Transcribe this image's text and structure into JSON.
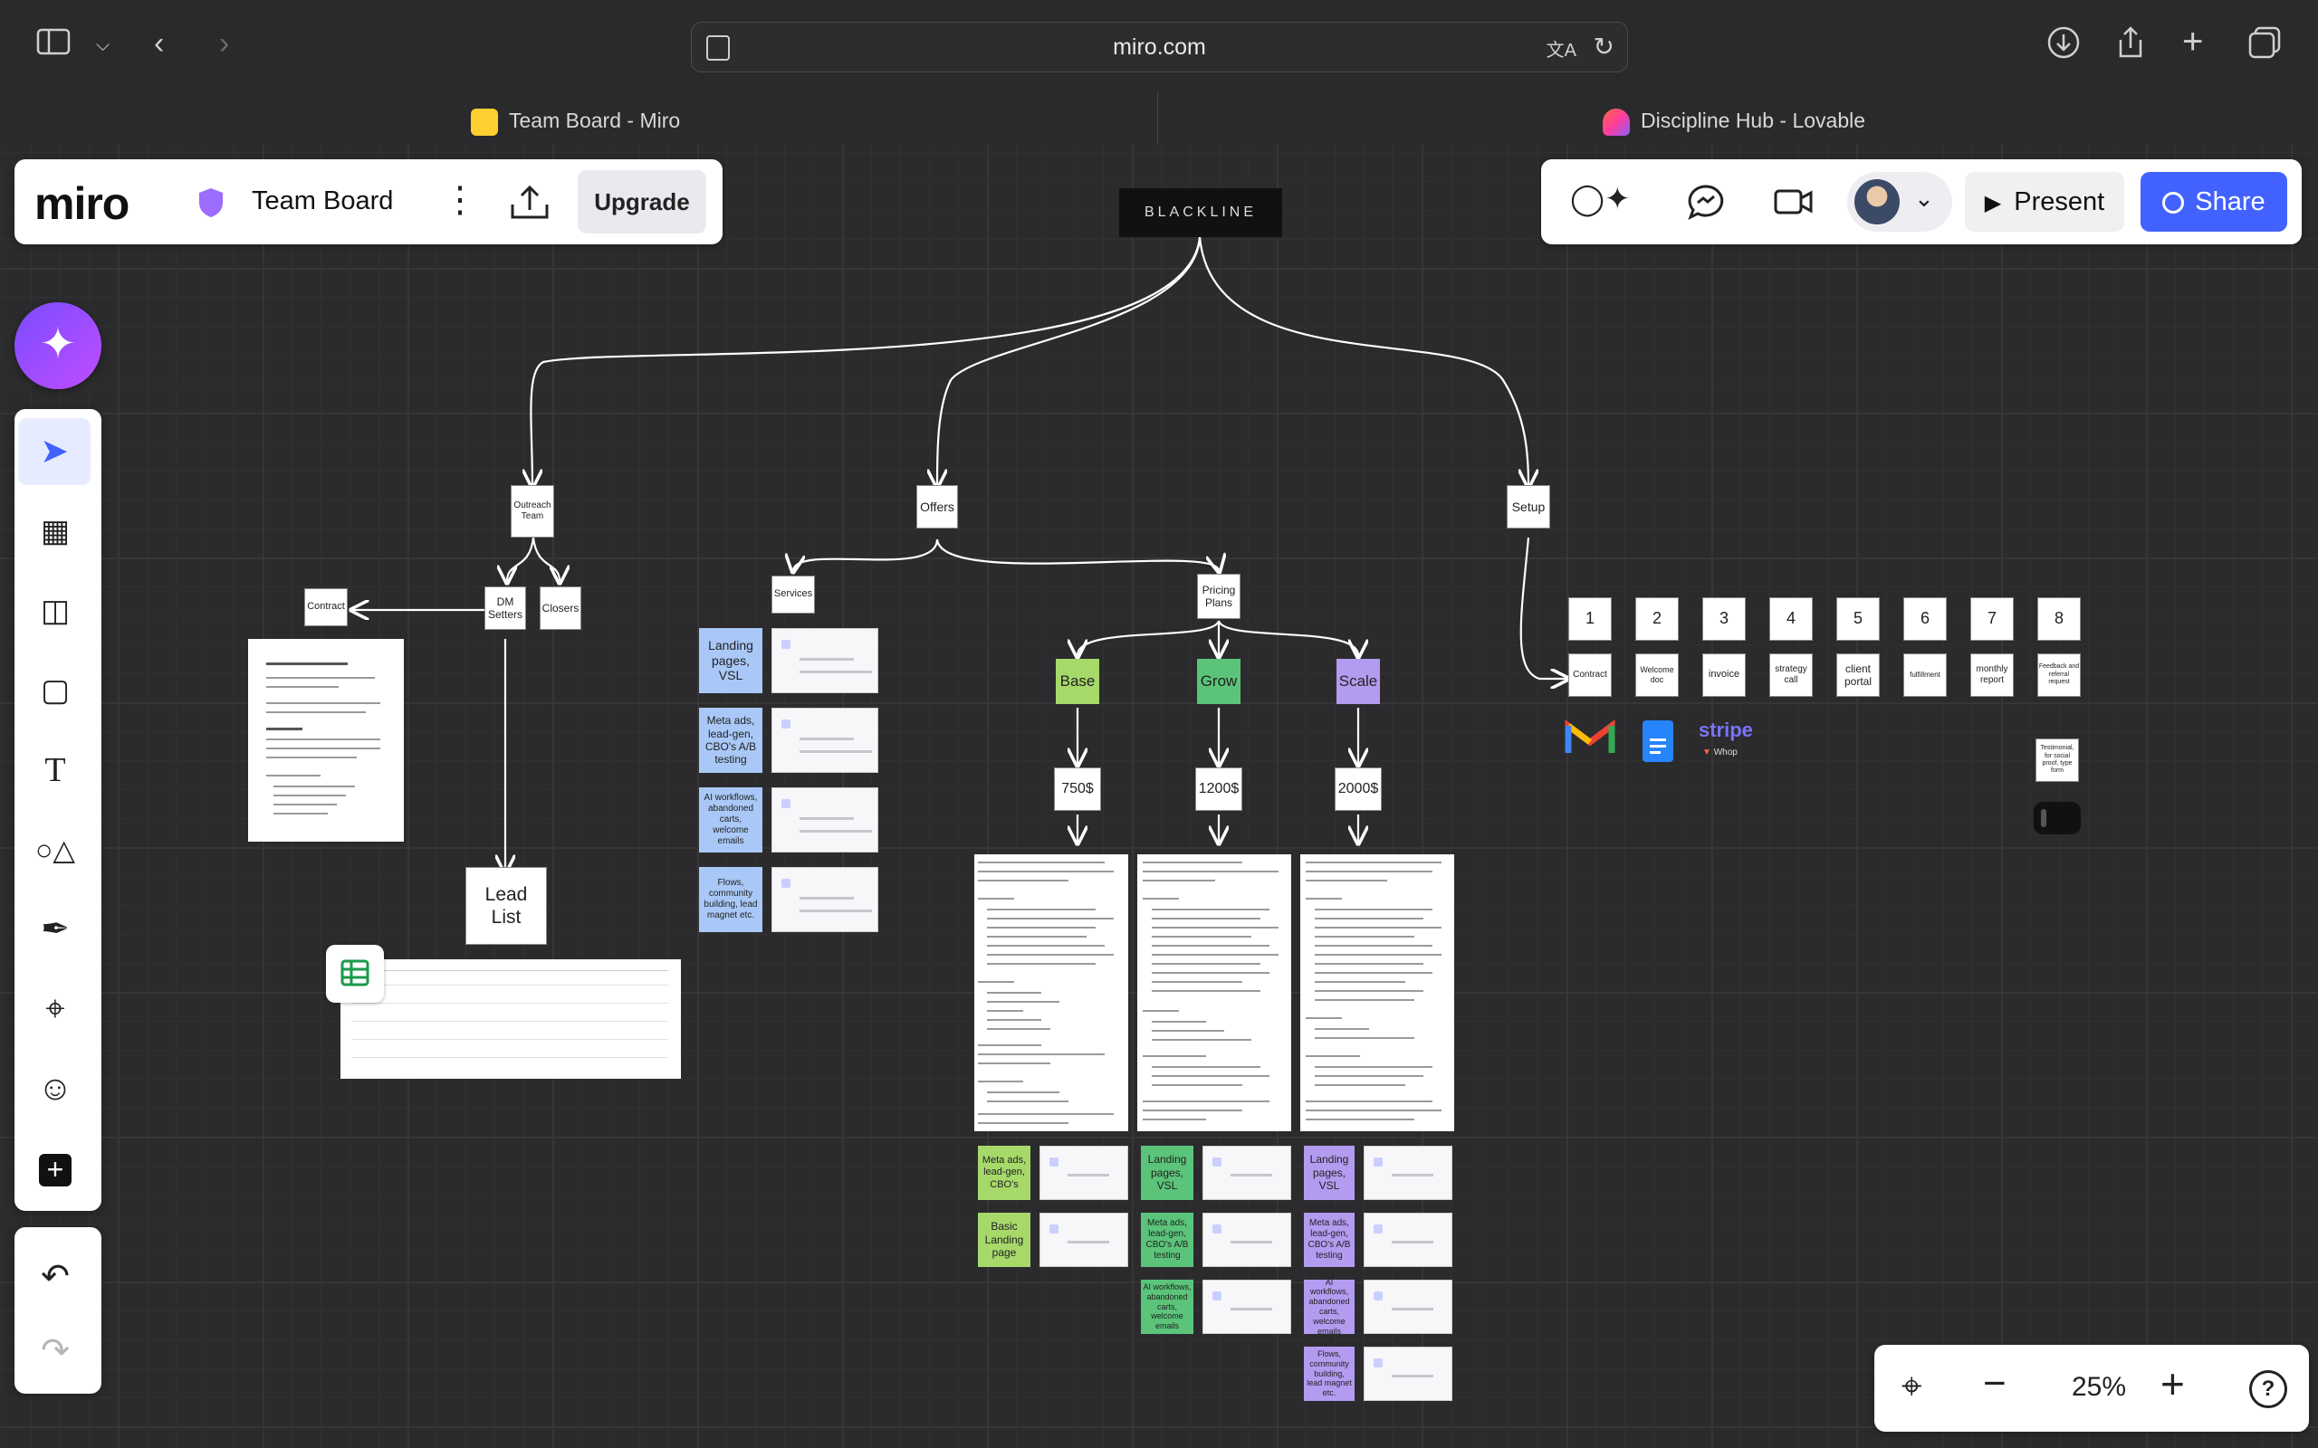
{
  "browser": {
    "url": "miro.com",
    "tabs": [
      {
        "label": "Team Board - Miro",
        "active": true
      },
      {
        "label": "Discipline Hub - Lovable",
        "active": false
      }
    ]
  },
  "miro": {
    "logo": "miro",
    "board_name": "Team Board",
    "upgrade_label": "Upgrade",
    "present_label": "Present",
    "share_label": "Share",
    "zoom_level": "25%",
    "accent": "#4262ff"
  },
  "board": {
    "brand": "BLACKLINE",
    "branches": [
      "Outreach Team",
      "Offers",
      "Setup"
    ],
    "outreach": {
      "dm_setters": "DM Setters",
      "closers": "Closers",
      "contract": "Contract",
      "lead_list": "Lead List"
    },
    "offers": {
      "services": "Services",
      "pricing_plans": "Pricing Plans"
    },
    "services": [
      "Landing pages, VSL",
      "Meta ads, lead-gen, CBO's A/B testing",
      "AI workflows, abandoned carts, welcome emails",
      "Flows, community building, lead magnet etc."
    ],
    "plans": [
      {
        "name": "Base",
        "price": "750$",
        "color": "#a6d96a",
        "items": [
          "Meta ads, lead-gen, CBO's",
          "Basic Landing page"
        ]
      },
      {
        "name": "Grow",
        "price": "1200$",
        "color": "#5bc47a",
        "items": [
          "Landing pages, VSL",
          "Meta ads, lead-gen, CBO's A/B testing",
          "AI workflows, abandoned carts, welcome emails"
        ]
      },
      {
        "name": "Scale",
        "price": "2000$",
        "color": "#b39bf0",
        "items": [
          "Landing pages, VSL",
          "Meta ads, lead-gen, CBO's A/B testing",
          "AI workflows, abandoned carts, welcome emails",
          "Flows, community building, lead magnet etc."
        ]
      }
    ],
    "setup_numbers": [
      "1",
      "2",
      "3",
      "4",
      "5",
      "6",
      "7",
      "8"
    ],
    "setup_steps": [
      "Contract",
      "Welcome doc",
      "invoice",
      "strategy call",
      "client portal",
      "fulfillment",
      "monthly report",
      "Feedback and referral request"
    ],
    "testimonial": "Testimonial, for social proof, type form",
    "stripe_label": "stripe",
    "stripe_sub": "Whop"
  }
}
